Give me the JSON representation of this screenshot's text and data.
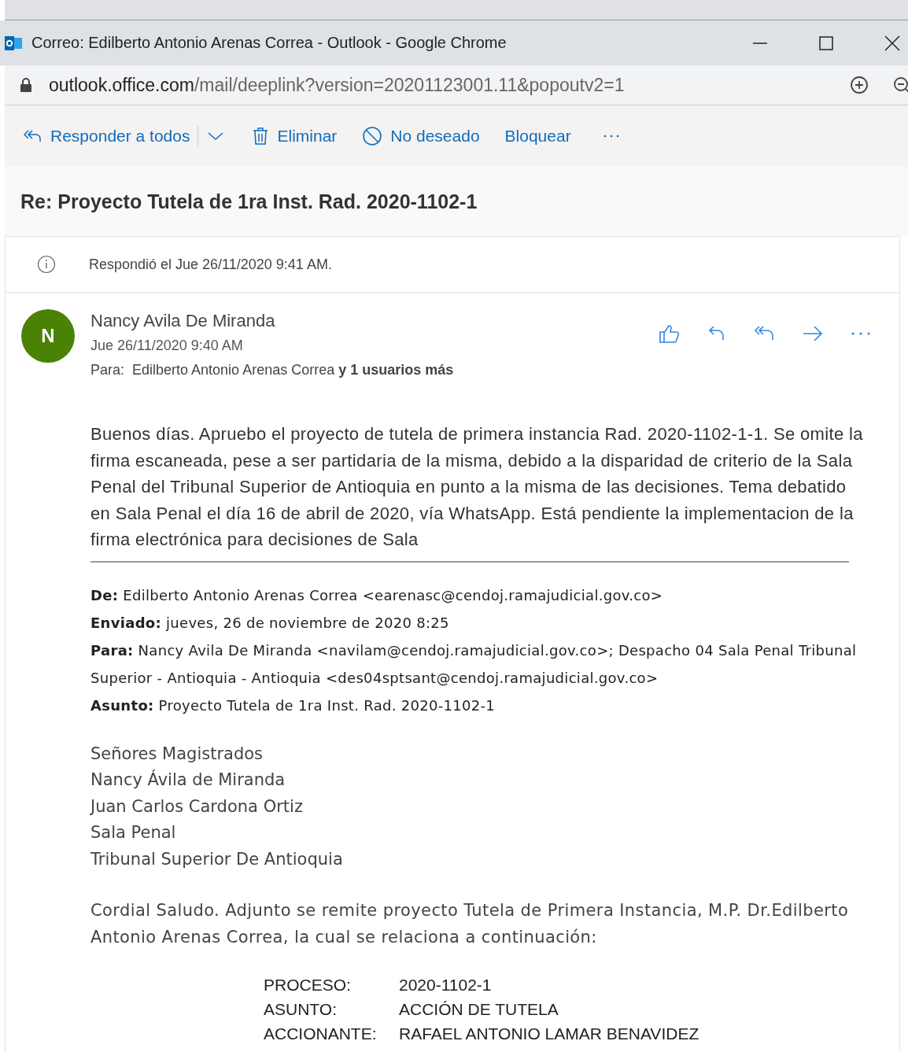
{
  "window": {
    "title": "Correo: Edilberto Antonio Arenas Correa - Outlook - Google Chrome"
  },
  "address_bar": {
    "host": "outlook.office.com",
    "path": "/mail/deeplink?version=20201123001.11&popoutv2=1"
  },
  "toolbar": [
    {
      "kind": "reply-all",
      "label": "Responder a todos"
    },
    {
      "kind": "delete",
      "label": "Eliminar"
    },
    {
      "kind": "junk",
      "label": "No deseado"
    },
    {
      "kind": "block",
      "label": "Bloquear"
    }
  ],
  "subject": "Re: Proyecto Tutela de 1ra Inst. Rad. 2020-1102-1",
  "notice": "Respondió el Jue 26/11/2020 9:41 AM.",
  "message": {
    "avatar_initial": "N",
    "sender": "Nancy Avila De Miranda",
    "date": "Jue 26/11/2020 9:40 AM",
    "to_label": "Para:",
    "to_names": "Edilberto Antonio Arenas Correa",
    "to_more": "y 1 usuarios más",
    "body": "Buenos días. Apruebo el proyecto de tutela de primera instancia Rad. 2020-1102-1-1. Se omite la firma escaneada, pese a ser partidaria de la misma, debido a la disparidad de criterio de la Sala Penal del Tribunal Superior de Antioquia en punto a la misma de las decisiones. Tema debatido en Sala Penal el día 16 de abril de 2020, vía WhatsApp. Está pendiente la implementacion de la firma electrónica para decisiones de Sala",
    "quoted_header": [
      {
        "label": "De:",
        "value": "Edilberto Antonio Arenas Correa <earenasc@cendoj.ramajudicial.gov.co>"
      },
      {
        "label": "Enviado:",
        "value": "jueves, 26 de noviembre de 2020 8:25"
      },
      {
        "label": "Para:",
        "value": "Nancy Avila De Miranda <navilam@cendoj.ramajudicial.gov.co>; Despacho 04 Sala Penal Tribunal Superior - Antioquia - Antioquia <des04sptsant@cendoj.ramajudicial.gov.co>"
      },
      {
        "label": "Asunto:",
        "value": "Proyecto Tutela de 1ra Inst. Rad. 2020-1102-1"
      }
    ],
    "addressee_lines": [
      "Señores Magistrados",
      "Nancy Ávila de Miranda",
      "Juan Carlos Cardona Ortiz",
      "Sala Penal",
      "Tribunal Superior De Antioquia"
    ],
    "greeting": "Cordial Saludo. Adjunto se remite proyecto Tutela de Primera Instancia, M.P. Dr.Edilberto Antonio Arenas Correa, la cual se relaciona a continuación:",
    "details": [
      {
        "label": "PROCESO:",
        "value": "2020-1102-1"
      },
      {
        "label": "ASUNTO:",
        "value": "ACCIÓN DE TUTELA"
      },
      {
        "label": "ACCIONANTE:",
        "value": "RAFAEL ANTONIO LAMAR BENAVIDEZ"
      }
    ]
  }
}
